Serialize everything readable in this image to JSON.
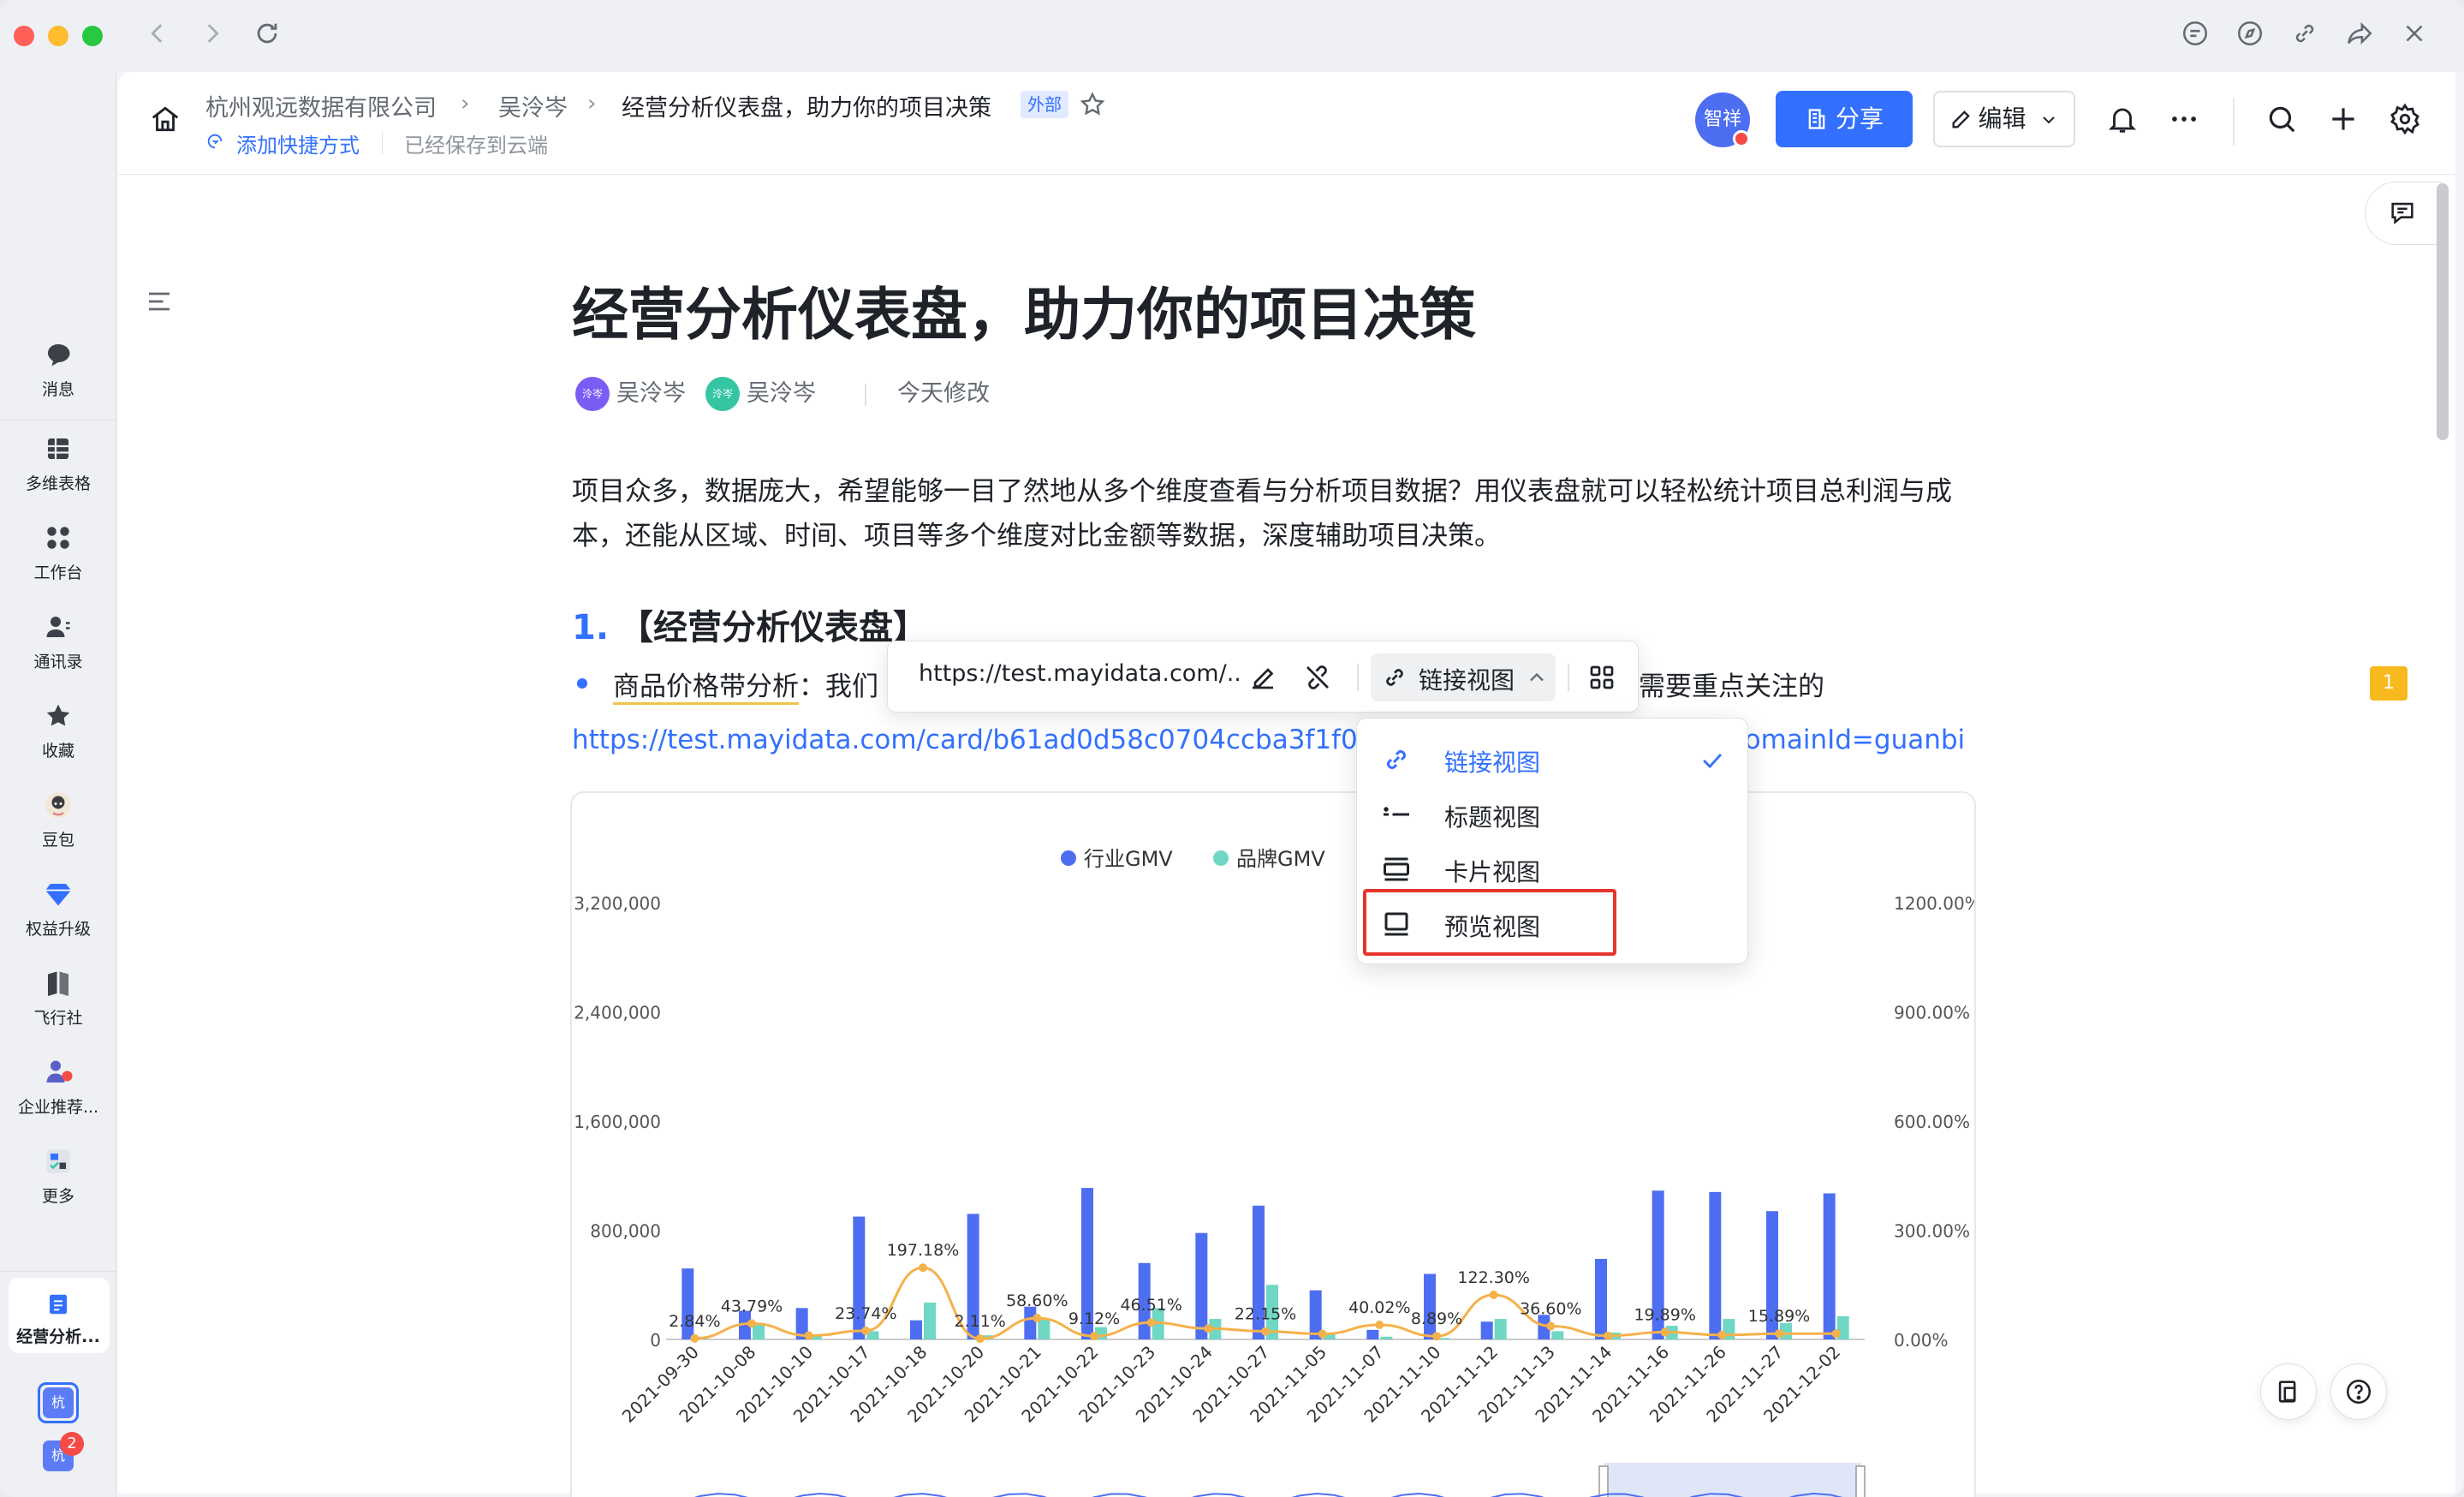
{
  "window": {
    "traffic_colors": [
      "#fe5f57",
      "#febc2e",
      "#28c840"
    ]
  },
  "sidebar": {
    "user_avatar": "泠岑",
    "items": [
      {
        "label": "消息",
        "icon": "chat-bubble-icon"
      },
      {
        "label": "多维表格",
        "icon": "table-icon"
      },
      {
        "label": "工作台",
        "icon": "grid-apps-icon"
      },
      {
        "label": "通讯录",
        "icon": "contacts-icon"
      },
      {
        "label": "收藏",
        "icon": "star-icon"
      },
      {
        "label": "豆包",
        "icon": "doubao-icon"
      },
      {
        "label": "权益升级",
        "icon": "diamond-icon"
      },
      {
        "label": "飞行社",
        "icon": "book-icon"
      },
      {
        "label": "企业推荐...",
        "icon": "enterprise-icon"
      },
      {
        "label": "更多",
        "icon": "more-apps-icon"
      }
    ],
    "active_doc_label": "经营分析...",
    "tenant_a": "杭",
    "tenant_b": "杭",
    "tenant_b_badge": "2"
  },
  "header": {
    "breadcrumb": [
      "杭州观远数据有限公司",
      "吴泠岑",
      "经营分析仪表盘，助力你的项目决策"
    ],
    "external_badge": "外部",
    "add_shortcut": "添加快捷方式",
    "saved_status": "已经保存到云端",
    "collaborator_avatar": "智祥",
    "share_label": "分享",
    "edit_label": "编辑"
  },
  "doc": {
    "title": "经营分析仪表盘，助力你的项目决策",
    "author1": "吴泠岑",
    "author2": "吴泠岑",
    "author1_avatar": "泠岑",
    "author2_avatar": "泠岑",
    "modified": "今天修改",
    "intro": "项目众多，数据庞大，希望能够一目了然地从多个维度查看与分析项目数据？用仪表盘就可以轻松统计项目总利润与成本，还能从区域、时间、项目等多个维度对比金额等数据，深度辅助项目决策。",
    "section_num": "1.",
    "section_title": "【经营分析仪表盘】",
    "bullet_highlight": "商品价格带分析",
    "bullet_rest": "：我们",
    "bullet_tail": "需要重点关注的",
    "link_text": "https://test.mayidata.com/card/b61ad0d58c0704ccba3f1f01?ps",
    "link_tail": "domainId=guanbi",
    "comment_count": "1"
  },
  "link_toolbar": {
    "url": "https://test.mayidata.com/...",
    "view_label": "链接视图"
  },
  "dropdown": {
    "items": [
      {
        "label": "链接视图",
        "icon": "link-icon",
        "selected": true
      },
      {
        "label": "标题视图",
        "icon": "title-view-icon",
        "selected": false
      },
      {
        "label": "卡片视图",
        "icon": "card-view-icon",
        "selected": false
      },
      {
        "label": "预览视图",
        "icon": "preview-view-icon",
        "selected": false
      }
    ]
  },
  "chart_data": {
    "type": "bar",
    "legend": [
      "行业GMV",
      "品牌GMV"
    ],
    "colors": {
      "industry": "#4e6ef2",
      "brand": "#6fd7c3",
      "line": "#f5b14a"
    },
    "categories": [
      "2021-09-30",
      "2021-10-08",
      "2021-10-10",
      "2021-10-17",
      "2021-10-18",
      "2021-10-20",
      "2021-10-21",
      "2021-10-22",
      "2021-10-23",
      "2021-10-24",
      "2021-10-27",
      "2021-11-05",
      "2021-11-07",
      "2021-11-10",
      "2021-11-12",
      "2021-11-13",
      "2021-11-14",
      "2021-11-16",
      "2021-11-26",
      "2021-11-27",
      "2021-12-02"
    ],
    "series": [
      {
        "name": "行业GMV",
        "values": [
          520000,
          210000,
          230000,
          900000,
          140000,
          920000,
          240000,
          1110000,
          560000,
          780000,
          980000,
          360000,
          70000,
          480000,
          130000,
          180000,
          590000,
          1090000,
          1080000,
          940000,
          1070000
        ]
      },
      {
        "name": "品牌GMV",
        "values": [
          20000,
          120000,
          30000,
          60000,
          270000,
          30000,
          150000,
          90000,
          230000,
          150000,
          400000,
          40000,
          20000,
          10000,
          150000,
          60000,
          50000,
          100000,
          150000,
          120000,
          170000
        ]
      }
    ],
    "line_values": [
      2.84,
      43.79,
      10.5,
      23.74,
      197.18,
      2.11,
      58.6,
      9.12,
      46.51,
      30.0,
      22.15,
      15.0,
      40.02,
      8.89,
      122.3,
      36.6,
      10.0,
      19.89,
      12.0,
      15.89,
      16.0
    ],
    "line_labels": [
      "2.84%",
      "43.79%",
      "",
      "23.74%",
      "197.18%",
      "2.11%",
      "58.60%",
      "9.12%",
      "46.51%",
      "",
      "22.15%",
      "",
      "40.02%",
      "8.89%",
      "122.30%",
      "36.60%",
      "",
      "19.89%",
      "",
      "15.89%",
      ""
    ],
    "y_left_ticks": [
      "3,200,000",
      "2,400,000",
      "1,600,000",
      "800,000",
      "0"
    ],
    "y_right_ticks": [
      "1200.00%",
      "900.00%",
      "600.00%",
      "300.00%",
      "0.00%"
    ],
    "ylim": [
      0,
      3200000
    ],
    "y2lim": [
      0,
      1200
    ]
  }
}
